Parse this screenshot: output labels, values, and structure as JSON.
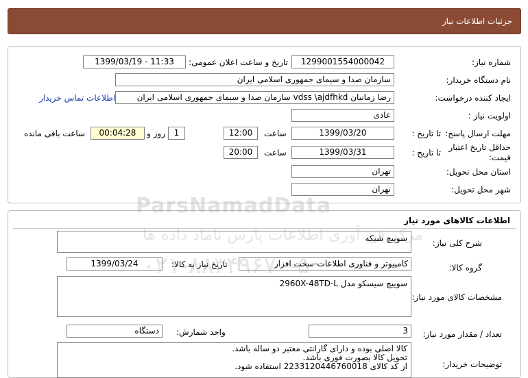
{
  "header": {
    "title": "جزئیات اطلاعات نیاز"
  },
  "info": {
    "need_number_label": "شماره نیاز:",
    "need_number": "1299001554000042",
    "announce_label": "تاریخ و ساعت اعلان عمومی:",
    "announce_value": "1399/03/19 - 11:33",
    "buyer_label": "نام دستگاه خریدار:",
    "buyer_value": "سازمان صدا و سیمای جمهوری اسلامی ایران",
    "creator_label": "ایجاد کننده درخواست:",
    "creator_value": "رضا زمانیان vdss \\ajdfhkd سازمان صدا و سیمای جمهوری اسلامی ایران",
    "contact_link": "اطلاعات تماس خریدار",
    "priority_label": "اولویت نیاز :",
    "priority_value": "عادی",
    "deadline_label": "مهلت ارسال پاسخ:",
    "to_date_label": "تا تاریخ :",
    "deadline_date": "1399/03/20",
    "time_label": "ساعت",
    "deadline_time": "12:00",
    "days_value": "1",
    "days_label": "روز و",
    "remaining_value": "00:04:28",
    "remaining_label": "ساعت باقی مانده",
    "validity_label_1": "حداقل تاریخ اعتبار",
    "validity_label_2": "قیمت:",
    "validity_date": "1399/03/31",
    "validity_time": "20:00",
    "province_label": "استان محل تحویل:",
    "province_value": "تهران",
    "city_label": "شهر محل تحویل:",
    "city_value": "تهران"
  },
  "goods": {
    "section_title": "اطلاعات کالاهای مورد نیاز",
    "summary_label": "شرح کلی نیاز:",
    "summary_value": "سوییچ شبکه",
    "group_label": "گروه کالا:",
    "group_value": "کامپیوتر و فناوری اطلاعات-سخت افزار",
    "need_date_label": "تاریخ نیاز به کالا:",
    "need_date_value": "1399/03/24",
    "specs_label": "مشخصات کالای مورد نیاز:",
    "specs_value": "سوییچ سیسکو مدل 2960X-48TD-L",
    "qty_label": "تعداد / مقدار مورد نیاز:",
    "qty_value": "3",
    "unit_label": "واحد شمارش:",
    "unit_value": "دستگاه",
    "notes_label": "توضیحات خریدار:",
    "notes_lines": [
      "کالا اصلی بوده و دارای گارانتی معتبر دو ساله باشد.",
      "تحویل کالا بصورت فوری باشد.",
      "از کد کالای 2233120446760018 استفاده شود."
    ]
  },
  "watermark": {
    "brand": "ParsNamadData",
    "tagline": "مرکز فن آوری اطلاعات پارس ناماد داده ها",
    "phone": "۰۲۱-۸۸۳۴۹۶۷۰-۵"
  },
  "colors": {
    "header_bg": "#8b4a33",
    "remaining_bg": "#fffdd0",
    "link": "#1a3fa6"
  }
}
